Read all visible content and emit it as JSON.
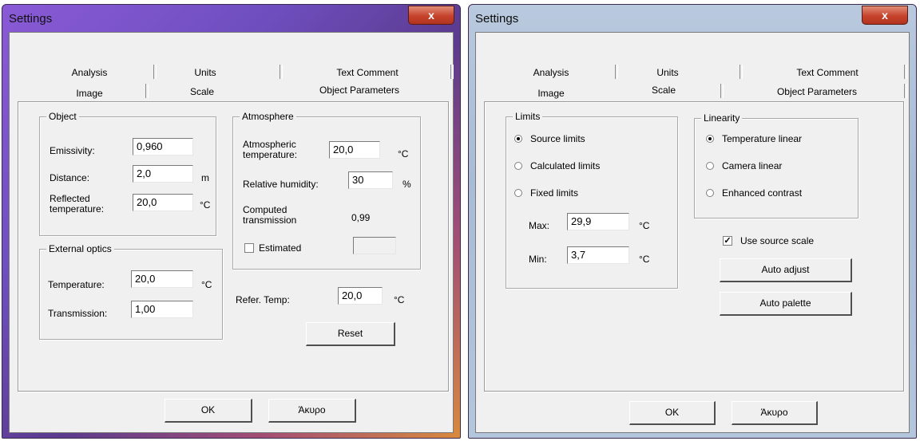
{
  "left": {
    "title": "Settings",
    "close": "x",
    "tabs": {
      "analysis": "Analysis",
      "units": "Units",
      "text_comment": "Text Comment",
      "image": "Image",
      "scale": "Scale",
      "object_parameters": "Object Parameters"
    },
    "object": {
      "legend": "Object",
      "emissivity_label": "Emissivity:",
      "emissivity_value": "0,960",
      "distance_label": "Distance:",
      "distance_value": "2,0",
      "distance_unit": "m",
      "reflected_label": "Reflected temperature:",
      "reflected_value": "20,0",
      "reflected_unit": "°C"
    },
    "atmosphere": {
      "legend": "Atmosphere",
      "atm_temp_label": "Atmospheric temperature:",
      "atm_temp_value": "20,0",
      "atm_temp_unit": "°C",
      "humidity_label": "Relative humidity:",
      "humidity_value": "30",
      "humidity_unit": "%",
      "computed_label": "Computed transmission",
      "computed_value": "0,99",
      "estimated_label": "Estimated",
      "estimated_value": ""
    },
    "external_optics": {
      "legend": "External optics",
      "temp_label": "Temperature:",
      "temp_value": "20,0",
      "temp_unit": "°C",
      "trans_label": "Transmission:",
      "trans_value": "1,00"
    },
    "refer": {
      "label": "Refer. Temp:",
      "value": "20,0",
      "unit": "°C"
    },
    "reset": "Reset",
    "ok": "OK",
    "cancel": "Άκυρο"
  },
  "right": {
    "title": "Settings",
    "close": "x",
    "tabs": {
      "analysis": "Analysis",
      "units": "Units",
      "text_comment": "Text Comment",
      "image": "Image",
      "scale": "Scale",
      "object_parameters": "Object Parameters"
    },
    "limits": {
      "legend": "Limits",
      "source": "Source limits",
      "calculated": "Calculated limits",
      "fixed": "Fixed limits",
      "max_label": "Max:",
      "max_value": "29,9",
      "max_unit": "°C",
      "min_label": "Min:",
      "min_value": "3,7",
      "min_unit": "°C"
    },
    "linearity": {
      "legend": "Linearity",
      "temperature": "Temperature linear",
      "camera": "Camera linear",
      "enhanced": "Enhanced contrast"
    },
    "use_source_scale": "Use source scale",
    "check_mark": "✓",
    "auto_adjust": "Auto adjust",
    "auto_palette": "Auto palette",
    "ok": "OK",
    "cancel": "Άκυρο"
  }
}
